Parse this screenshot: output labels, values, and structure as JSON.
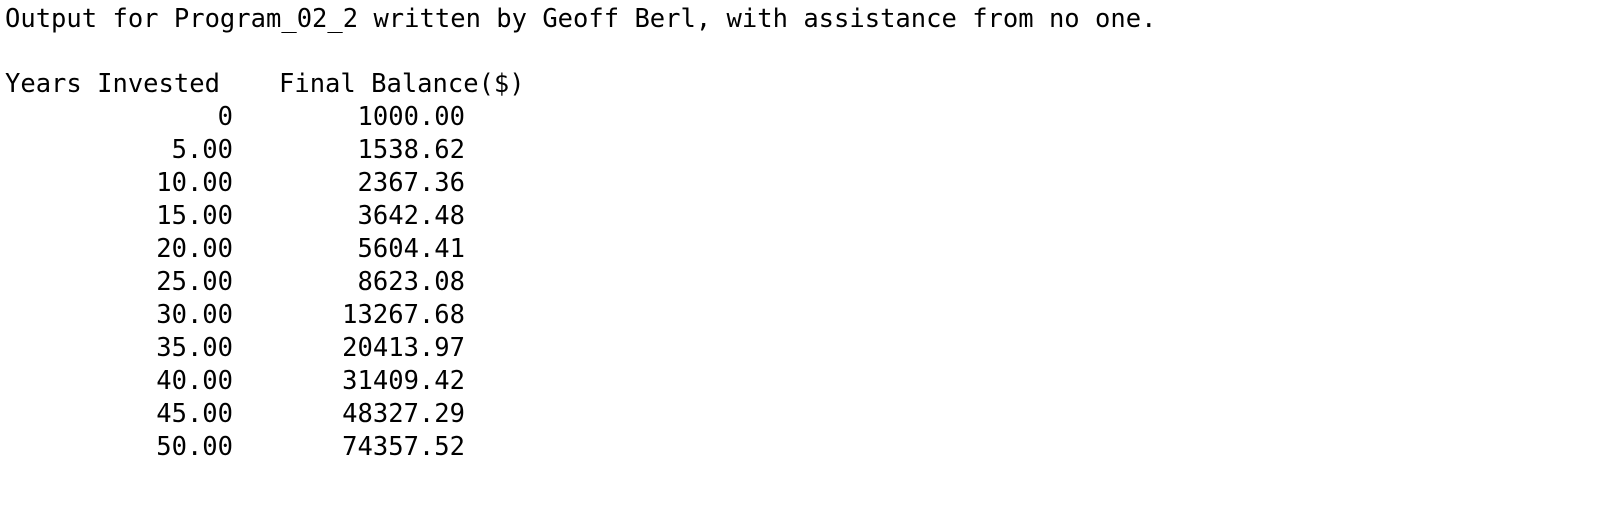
{
  "output": {
    "banner": "Output for Program_02_2 written by Geoff Berl, with assistance from no one.",
    "table": {
      "headers": {
        "years": "Years Invested",
        "balance": "Final Balance($)"
      },
      "rows": [
        {
          "years": "0",
          "balance": "1000.00"
        },
        {
          "years": "5.00",
          "balance": "1538.62"
        },
        {
          "years": "10.00",
          "balance": "2367.36"
        },
        {
          "years": "15.00",
          "balance": "3642.48"
        },
        {
          "years": "20.00",
          "balance": "5604.41"
        },
        {
          "years": "25.00",
          "balance": "8623.08"
        },
        {
          "years": "30.00",
          "balance": "13267.68"
        },
        {
          "years": "35.00",
          "balance": "20413.97"
        },
        {
          "years": "40.00",
          "balance": "31409.42"
        },
        {
          "years": "45.00",
          "balance": "48327.29"
        },
        {
          "years": "50.00",
          "balance": "74357.52"
        }
      ]
    }
  }
}
